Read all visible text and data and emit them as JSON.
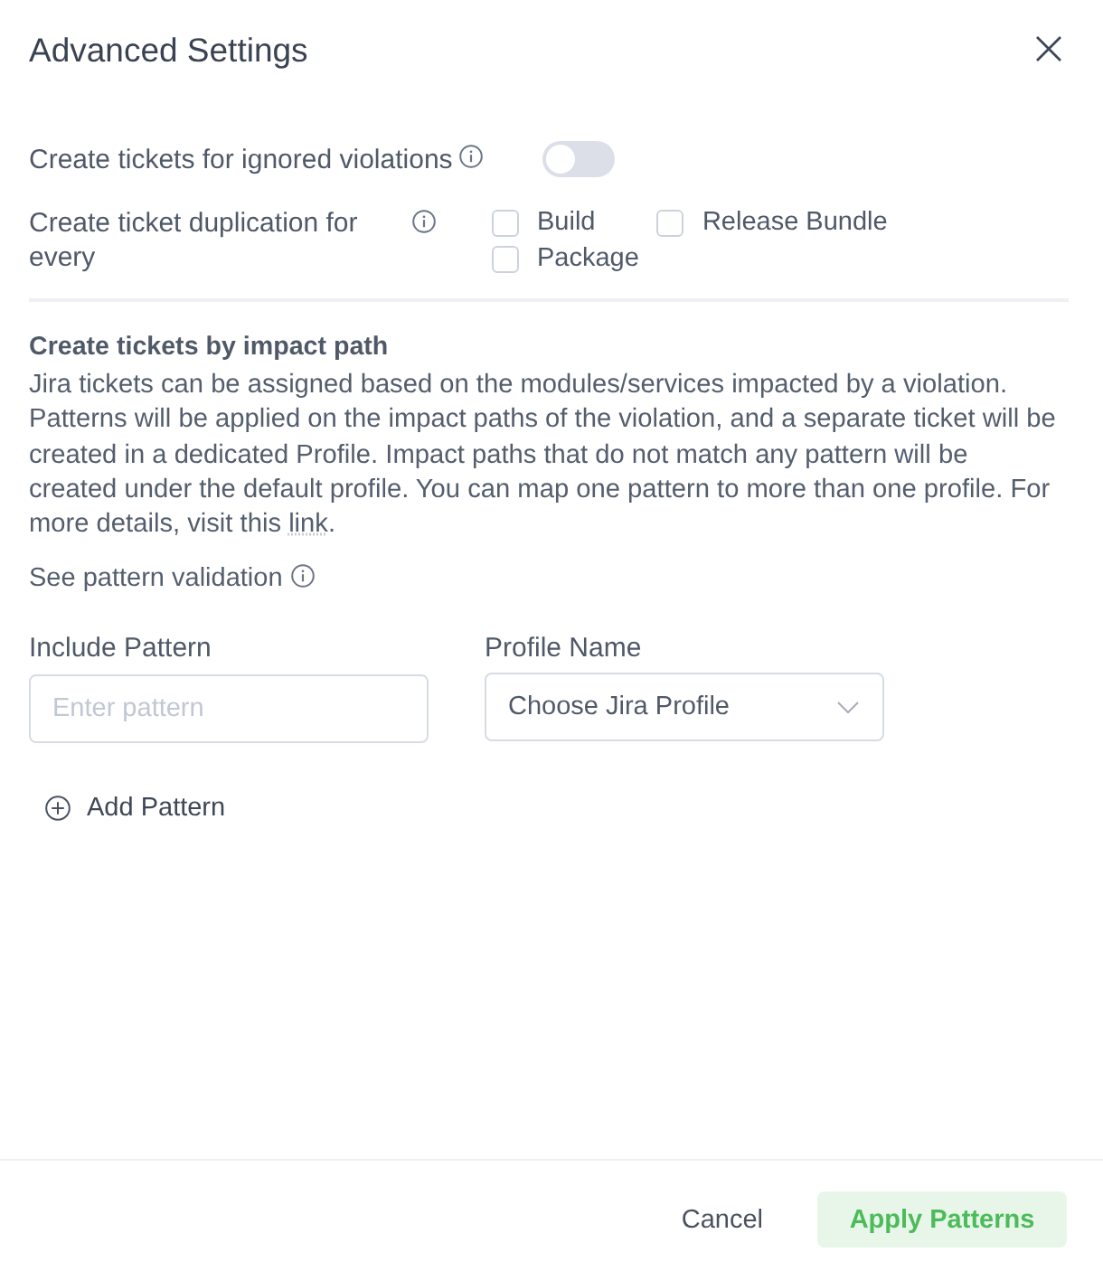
{
  "dialog": {
    "title": "Advanced Settings"
  },
  "settings": [
    {
      "kind": "toggle",
      "label": "Create tickets for ignored violations",
      "on": false
    },
    {
      "kind": "checkboxes",
      "label": "Create ticket duplication for every",
      "options": [
        {
          "label": "Build",
          "checked": false
        },
        {
          "label": "Release Bundle",
          "checked": false
        },
        {
          "label": "Package",
          "checked": false
        }
      ]
    }
  ],
  "impact_path": {
    "heading": "Create tickets by impact path",
    "description": "Jira tickets can be assigned based on the modules/services impacted by a violation. Patterns will be applied on the impact paths of the violation, and a separate ticket will be created in a dedicated Profile. Impact paths that do not match any pattern will be created under the default profile. You can map one pattern to more than one profile. For more details, visit this ",
    "link": "link",
    "description_end": ".",
    "validation_label": "See pattern validation"
  },
  "pattern": {
    "include_label": "Include Pattern",
    "include_placeholder": "Enter pattern",
    "profile_label": "Profile Name",
    "profile_value": "Choose Jira Profile"
  },
  "add_button": "Add Pattern",
  "footer": {
    "buttons": [
      {
        "label": "Cancel",
        "kind": "secondary"
      },
      {
        "label": "Apply Patterns",
        "kind": "primary"
      }
    ]
  }
}
